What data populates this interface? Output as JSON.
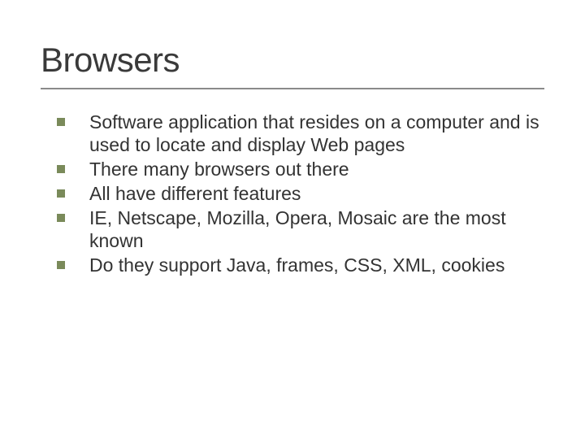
{
  "title": "Browsers",
  "bullets": [
    "Software application that resides on a computer and is used to locate and display Web pages",
    "There many browsers out there",
    "All have different features",
    "IE, Netscape, Mozilla, Opera, Mosaic are the most known",
    "Do they support Java, frames, CSS, XML, cookies"
  ]
}
